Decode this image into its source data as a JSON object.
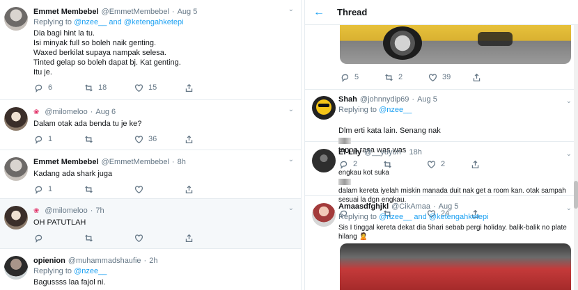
{
  "left_feed": {
    "tweets": [
      {
        "name": "Emmet Membebel",
        "handle": "@EmmetMembebel",
        "time": "Aug 5",
        "replying_prefix": "Replying to",
        "replying_links": "@nzee__ and @ketengahketepi",
        "text": "Dia bagi hint la tu.\nIsi minyak full so boleh naik genting.\nWaxed berkilat supaya nampak selesa.\nTinted gelap so boleh dapat bj. Kat genting.\nItu je.",
        "replies": "6",
        "retweets": "18",
        "likes": "15"
      },
      {
        "name": "",
        "handle": "@milomeloo",
        "time": "Aug 6",
        "text": "Dalam otak ada benda tu je ke?",
        "replies": "1",
        "retweets": "",
        "likes": "36"
      },
      {
        "name": "Emmet Membebel",
        "handle": "@EmmetMembebel",
        "time": "8h",
        "text": "Kadang ada shark juga",
        "replies": "1",
        "retweets": "",
        "likes": ""
      },
      {
        "name": "",
        "handle": "@milomeloo",
        "time": "7h",
        "text": "OH PATUTLAH",
        "replies": "",
        "retweets": "",
        "likes": ""
      },
      {
        "name": "opienion",
        "handle": "@muhammadshaufie",
        "time": "2h",
        "replying_prefix": "Replying to",
        "replying_links": "@nzee__",
        "text": "Bagussss laa fajol ni.",
        "replies": "",
        "retweets": "",
        "likes": ""
      }
    ]
  },
  "thread_panel": {
    "title": "Thread",
    "top_actions": {
      "replies": "5",
      "retweets": "2",
      "likes": "39"
    },
    "tweets": [
      {
        "name": "Shah",
        "handle": "@johnnydip69",
        "time": "Aug 5",
        "replying_prefix": "Replying to",
        "replying_links": "@nzee__",
        "text_a": "Dlm erti kata lain. Senang nak",
        "text_b": "tanpa rasa was was",
        "replies": "2",
        "retweets": "",
        "likes": "2"
      },
      {
        "name": "El-Lily",
        "handle": "@__yuyun",
        "time": "18h",
        "text_a": "engkau kot suka",
        "text_b": "dalam kereta iyelah miskin manada duit nak get a room kan. otak sampah sesuai la dgn engkau.",
        "replies": "",
        "retweets": "",
        "likes": "24"
      },
      {
        "name": "Amaasdfghjkl",
        "handle": "@CikAmaa",
        "time": "Aug 5",
        "replying_prefix": "Replying to",
        "replying_links": "@nzee__ and @ketengahketepi",
        "text": "Sis I tinggal kereta dekat dia 5hari sebab pergi holiday. balik-balik no plate hilang 🙎"
      }
    ]
  },
  "icons": {
    "reply": "reply-icon",
    "retweet": "retweet-icon",
    "like": "heart-icon",
    "share": "share-icon",
    "back": "back-arrow-icon"
  },
  "colors": {
    "accent": "#1da1f2",
    "muted": "#657786",
    "border": "#e6ecf0"
  }
}
